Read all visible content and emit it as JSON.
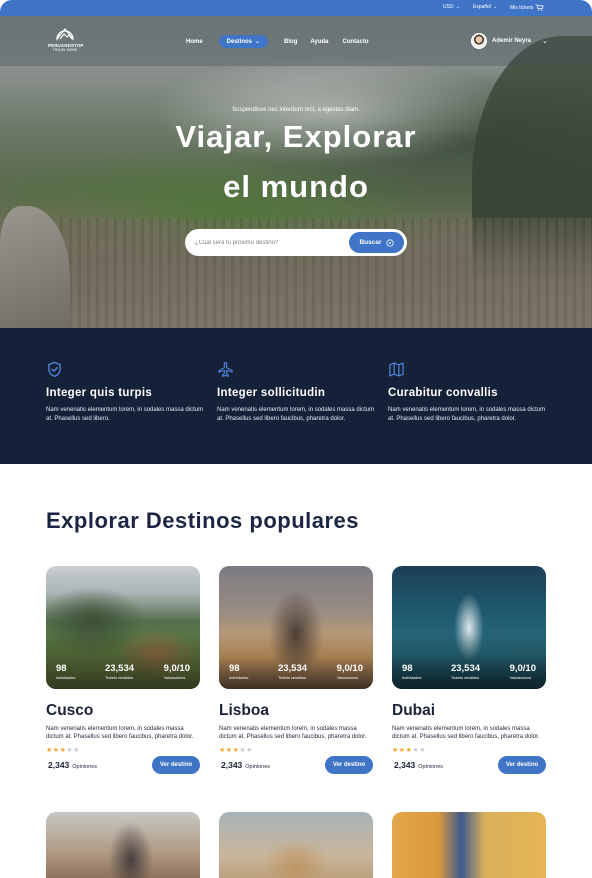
{
  "topbar": {
    "currency": "USD",
    "language": "Español",
    "trips": "Mis tickets"
  },
  "brand": {
    "name": "PERUANDSTOP",
    "tagline": "TRAVEL MORE"
  },
  "nav": {
    "links": [
      {
        "label": "Home"
      },
      {
        "label": "Destinos"
      },
      {
        "label": "Blog"
      },
      {
        "label": "Ayuda"
      },
      {
        "label": "Contacto"
      }
    ],
    "active_index": 1,
    "user_name": "Ademir Neyra"
  },
  "hero": {
    "subtitle": "Suspendisse nec interdum orci, a egestas diam.",
    "title_line1": "Viajar, Explorar",
    "title_line2": "el mundo",
    "search_placeholder": "¿Cual será tu próximo destino?",
    "search_button": "Buscar"
  },
  "features": [
    {
      "icon": "shield-check-icon",
      "title": "Integer quis turpis",
      "text": "Nam venenatis elementum lorem, in sodales massa dictum at. Phasellus sed libero."
    },
    {
      "icon": "airplane-icon",
      "title": "Integer sollicitudin",
      "text": "Nam venenatis elementum lorem, in sodales massa dictum at. Phasellus sed libero faucibus, pharetra dolor."
    },
    {
      "icon": "map-icon",
      "title": "Curabitur convallis",
      "text": "Nam venenatis elementum lorem, in sodales massa dictum at. Phasellus sed libero faucibus, pharetra dolor."
    }
  ],
  "popular": {
    "title": "Explorar Destinos populares",
    "destinations": [
      {
        "name": "Cusco",
        "stats": [
          {
            "value": "98",
            "label": "Actividades"
          },
          {
            "value": "23,534",
            "label": "Tickets vendidos"
          },
          {
            "value": "9,0/10",
            "label": "Valoraciones"
          }
        ],
        "description": "Nam venenatis elementum lorem, in sodales massa dictum at. Phasellus sed libero faucibus, pharetra dolor.",
        "rating": 3,
        "rating_max": 5,
        "reviews_count": "2,343",
        "reviews_label": "Opiniones",
        "button": "Ver destino"
      },
      {
        "name": "Lisboa",
        "stats": [
          {
            "value": "98",
            "label": "Actividades"
          },
          {
            "value": "23,534",
            "label": "Tickets vendidos"
          },
          {
            "value": "9,0/10",
            "label": "Valoraciones"
          }
        ],
        "description": "Nam venenatis elementum lorem, in sodales massa dictum at. Phasellus sed libero faucibus, pharetra dolor.",
        "rating": 3,
        "rating_max": 5,
        "reviews_count": "2,343",
        "reviews_label": "Opiniones",
        "button": "Ver destino"
      },
      {
        "name": "Dubai",
        "stats": [
          {
            "value": "98",
            "label": "Actividades"
          },
          {
            "value": "23,534",
            "label": "Tickets vendidos"
          },
          {
            "value": "9,0/10",
            "label": "Valoraciones"
          }
        ],
        "description": "Nam venenatis elementum lorem, in sodales massa dictum at. Phasellus sed libero faucibus, pharetra dolor.",
        "rating": 3,
        "rating_max": 5,
        "reviews_count": "2,343",
        "reviews_label": "Opiniones",
        "button": "Ver destino"
      }
    ]
  },
  "colors": {
    "accent": "#3f74c6",
    "dark_band": "#152039",
    "star_on": "#f2a634",
    "star_off": "#c8ccd3"
  }
}
